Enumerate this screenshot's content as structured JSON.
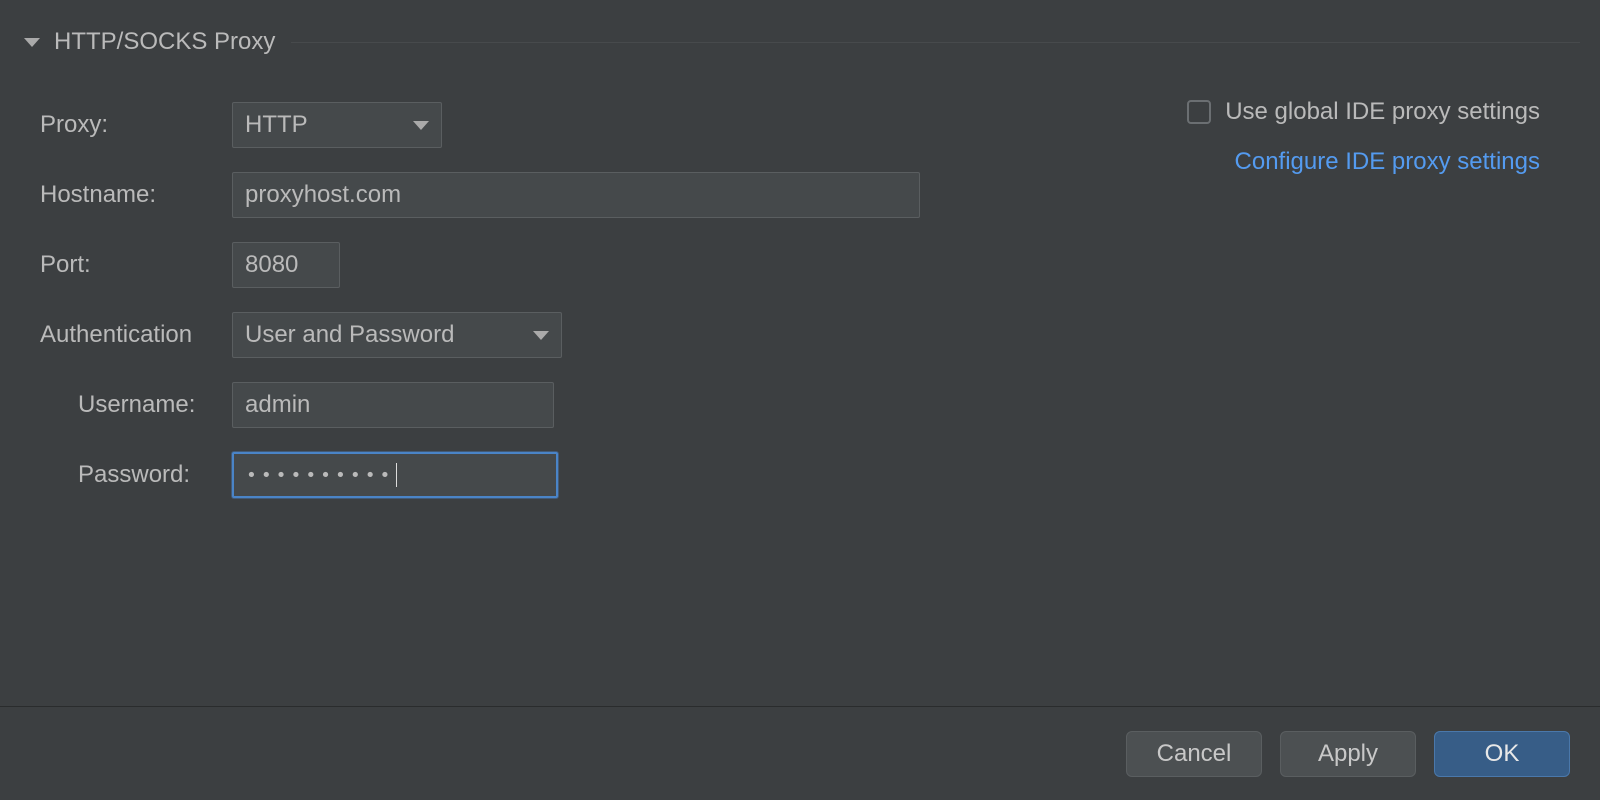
{
  "section": {
    "title": "HTTP/SOCKS Proxy"
  },
  "right": {
    "checkbox_label": "Use global IDE proxy settings",
    "link_text": "Configure IDE proxy settings"
  },
  "form": {
    "proxy": {
      "label": "Proxy:",
      "value": "HTTP"
    },
    "hostname": {
      "label": "Hostname:",
      "value": "proxyhost.com"
    },
    "port": {
      "label": "Port:",
      "value": "8080"
    },
    "authentication": {
      "label": "Authentication",
      "value": "User and Password"
    },
    "username": {
      "label": "Username:",
      "value": "admin"
    },
    "password": {
      "label": "Password:",
      "mask": "••••••••••"
    }
  },
  "buttons": {
    "cancel": "Cancel",
    "apply": "Apply",
    "ok": "OK"
  }
}
